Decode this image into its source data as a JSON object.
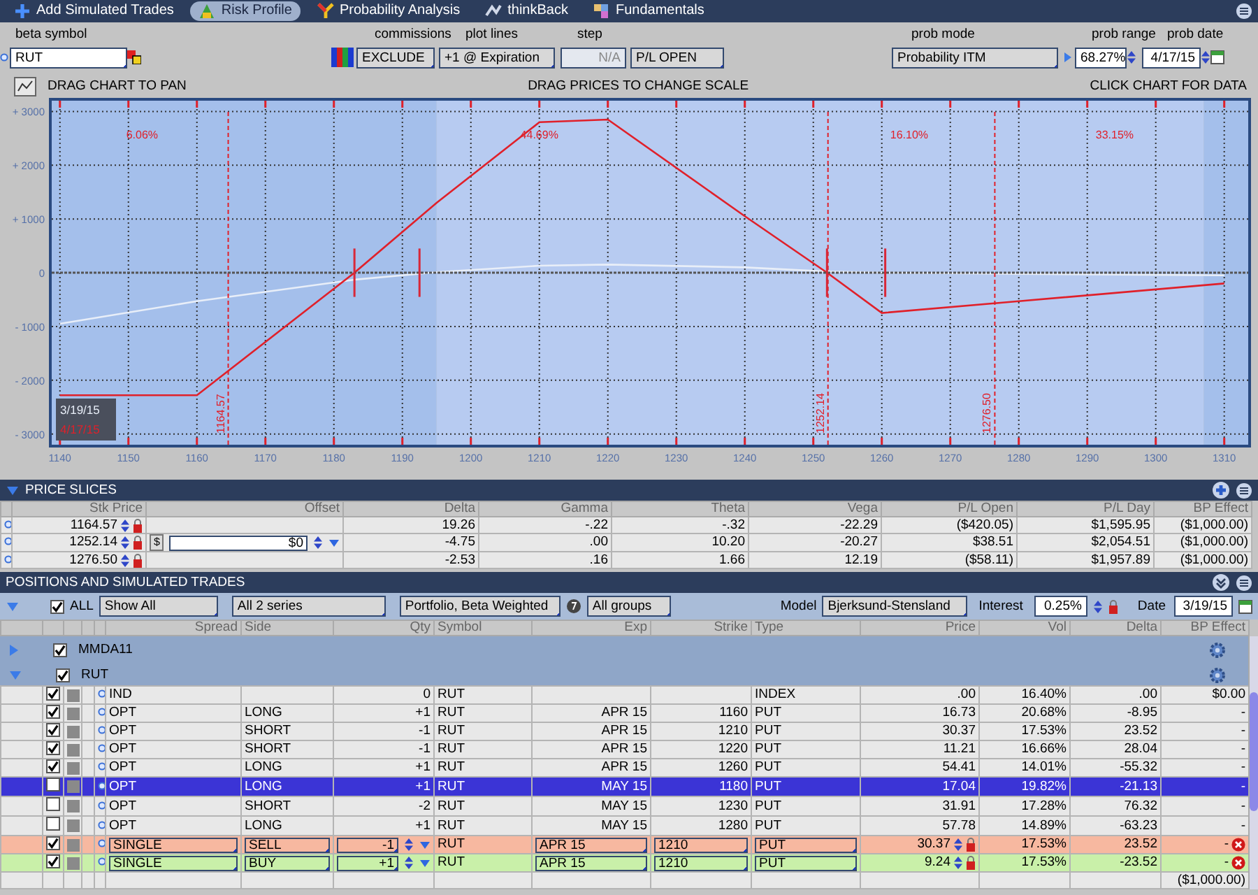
{
  "tabs": [
    {
      "label": "Add Simulated Trades",
      "selected": false
    },
    {
      "label": "Risk Profile",
      "selected": true
    },
    {
      "label": "Probability Analysis",
      "selected": false
    },
    {
      "label": "thinkBack",
      "selected": false
    },
    {
      "label": "Fundamentals",
      "selected": false
    }
  ],
  "settings": {
    "beta_symbol": {
      "label": "beta symbol",
      "value": "RUT"
    },
    "commissions": {
      "label": "commissions",
      "value": "EXCLUDE"
    },
    "plot_lines": {
      "label": "plot lines",
      "value": "+1 @ Expiration"
    },
    "step": {
      "label": "step",
      "value": "N/A",
      "disabled": true
    },
    "pl_mode": {
      "value": "P/L OPEN"
    },
    "prob_mode": {
      "label": "prob mode",
      "value": "Probability ITM"
    },
    "prob_range": {
      "label": "prob range",
      "value": "68.27%"
    },
    "prob_date": {
      "label": "prob date",
      "value": "4/17/15"
    }
  },
  "hints": [
    "DRAG CHART TO PAN",
    "DRAG PRICES TO CHANGE SCALE",
    "CLICK CHART FOR DATA"
  ],
  "risk_chart": {
    "chart_data": {
      "type": "line",
      "x": [
        1140,
        1160,
        1183,
        1195,
        1210,
        1220,
        1240,
        1252,
        1260,
        1280,
        1310
      ],
      "series": [
        {
          "name": "3/19/15",
          "color": "#e8eef8",
          "values": [
            -950,
            -530,
            -130,
            10,
            130,
            150,
            100,
            20,
            0,
            -20,
            -50
          ]
        },
        {
          "name": "4/17/15",
          "color": "#e0202a",
          "values": [
            -2280,
            -2280,
            0,
            1300,
            2800,
            2850,
            1050,
            0,
            -750,
            -530,
            -200
          ]
        }
      ],
      "xlim": [
        1138.8,
        1313.5
      ],
      "ylim": [
        -3200,
        3200
      ],
      "grid": true,
      "xticks": [
        1140,
        1150,
        1160,
        1170,
        1180,
        1190,
        1200,
        1210,
        1220,
        1230,
        1240,
        1250,
        1260,
        1270,
        1280,
        1290,
        1300,
        1310
      ],
      "yticks": [
        {
          "value": 3000,
          "label": "+ 3000"
        },
        {
          "value": 2000,
          "label": "+ 2000"
        },
        {
          "value": 1000,
          "label": "+ 1000"
        },
        {
          "value": 0,
          "label": "0"
        },
        {
          "value": -1000,
          "label": "- 1000"
        },
        {
          "value": -2000,
          "label": "- 2000"
        },
        {
          "value": -3000,
          "label": "- 3000"
        }
      ],
      "annotations": [
        "6.06%",
        "44.69%",
        "16.10%",
        "33.15%"
      ],
      "ref_lines": [
        {
          "axis": "x",
          "value": 1164.57,
          "label": "1164.57"
        },
        {
          "axis": "x",
          "value": 1252.14,
          "label": "1252.14"
        },
        {
          "axis": "x",
          "value": 1276.5,
          "label": "1276.50"
        },
        {
          "axis": "y",
          "value": 0
        }
      ],
      "bands": [
        {
          "axis": "x",
          "from": 1138.8,
          "to": 1195,
          "color": "#a4bfeb"
        },
        {
          "axis": "x",
          "from": 1195,
          "to": 1307,
          "color": "#b7cbf1"
        },
        {
          "axis": "x",
          "from": 1307,
          "to": 1313.5,
          "color": "#a4bfeb"
        }
      ]
    }
  },
  "price_slices": {
    "title": "PRICE SLICES",
    "columns": [
      "Stk Price",
      "Offset",
      "Delta",
      "Gamma",
      "Theta",
      "Vega",
      "P/L Open",
      "P/L Day",
      "BP Effect"
    ],
    "rows": [
      {
        "stk_price": "1164.57",
        "delta": "19.26",
        "gamma": "-.22",
        "theta": "-.32",
        "vega": "-22.29",
        "pl_open": "($420.05)",
        "pl_day": "$1,595.95",
        "bp_effect": "($1,000.00)"
      },
      {
        "stk_price": "1252.14",
        "offset_unit": "$",
        "offset": "$0",
        "delta": "-4.75",
        "gamma": ".00",
        "theta": "10.20",
        "vega": "-20.27",
        "pl_open": "$38.51",
        "pl_day": "$2,054.51",
        "bp_effect": "($1,000.00)"
      },
      {
        "stk_price": "1276.50",
        "delta": "-2.53",
        "gamma": ".16",
        "theta": "1.66",
        "vega": "12.19",
        "pl_open": "($58.11)",
        "pl_day": "$1,957.89",
        "bp_effect": "($1,000.00)"
      }
    ]
  },
  "positions": {
    "title": "POSITIONS AND SIMULATED TRADES",
    "filters": {
      "all_label": "ALL",
      "all_checked": true,
      "show": "Show All",
      "series": "All 2 series",
      "portfolio": "Portfolio, Beta Weighted",
      "groups": "All groups",
      "model_label": "Model",
      "model": "Bjerksund-Stensland",
      "interest_label": "Interest",
      "interest": "0.25%",
      "date_label": "Date",
      "date": "3/19/15"
    },
    "columns": [
      "Spread",
      "Side",
      "Qty",
      "Symbol",
      "Exp",
      "Strike",
      "Type",
      "Price",
      "Vol",
      "Delta",
      "BP Effect"
    ],
    "groups": [
      {
        "name": "MMDA11",
        "checked": true,
        "expanded": false
      },
      {
        "name": "RUT",
        "checked": true,
        "expanded": true,
        "rows": [
          {
            "kind": "position",
            "checked": true,
            "selected": false,
            "spread": "IND",
            "qty": "0",
            "symbol": "RUT",
            "type": "INDEX",
            "price": ".00",
            "vol": "16.40%",
            "delta": ".00",
            "bp_effect": "$0.00"
          },
          {
            "kind": "position",
            "checked": true,
            "selected": false,
            "spread": "OPT",
            "side": "LONG",
            "qty": "+1",
            "symbol": "RUT",
            "exp": "APR 15",
            "strike": "1160",
            "type": "PUT",
            "price": "16.73",
            "vol": "20.68%",
            "delta": "-8.95",
            "bp_effect": "-"
          },
          {
            "kind": "position",
            "checked": true,
            "selected": false,
            "spread": "OPT",
            "side": "SHORT",
            "qty": "-1",
            "symbol": "RUT",
            "exp": "APR 15",
            "strike": "1210",
            "type": "PUT",
            "price": "30.37",
            "vol": "17.53%",
            "delta": "23.52",
            "bp_effect": "-"
          },
          {
            "kind": "position",
            "checked": true,
            "selected": false,
            "spread": "OPT",
            "side": "SHORT",
            "qty": "-1",
            "symbol": "RUT",
            "exp": "APR 15",
            "strike": "1220",
            "type": "PUT",
            "price": "11.21",
            "vol": "16.66%",
            "delta": "28.04",
            "bp_effect": "-"
          },
          {
            "kind": "position",
            "checked": true,
            "selected": false,
            "spread": "OPT",
            "side": "LONG",
            "qty": "+1",
            "symbol": "RUT",
            "exp": "APR 15",
            "strike": "1260",
            "type": "PUT",
            "price": "54.41",
            "vol": "14.01%",
            "delta": "-55.32",
            "bp_effect": "-"
          },
          {
            "kind": "position",
            "checked": false,
            "selected": true,
            "spread": "OPT",
            "side": "LONG",
            "qty": "+1",
            "symbol": "RUT",
            "exp": "MAY 15",
            "strike": "1180",
            "type": "PUT",
            "price": "17.04",
            "vol": "19.82%",
            "delta": "-21.13",
            "bp_effect": "-"
          },
          {
            "kind": "position",
            "checked": false,
            "selected": false,
            "spread": "OPT",
            "side": "SHORT",
            "qty": "-2",
            "symbol": "RUT",
            "exp": "MAY 15",
            "strike": "1230",
            "type": "PUT",
            "price": "31.91",
            "vol": "17.28%",
            "delta": "76.32",
            "bp_effect": "-"
          },
          {
            "kind": "position",
            "checked": false,
            "selected": false,
            "spread": "OPT",
            "side": "LONG",
            "qty": "+1",
            "symbol": "RUT",
            "exp": "MAY 15",
            "strike": "1280",
            "type": "PUT",
            "price": "57.78",
            "vol": "14.89%",
            "delta": "-63.23",
            "bp_effect": "-"
          },
          {
            "kind": "sell",
            "checked": true,
            "selected": false,
            "spread": "SINGLE",
            "side": "SELL",
            "qty": "-1",
            "symbol": "RUT",
            "exp": "APR 15",
            "strike": "1210",
            "type": "PUT",
            "price": "30.37",
            "vol": "17.53%",
            "delta": "23.52",
            "bp_effect": "-"
          },
          {
            "kind": "buy",
            "checked": true,
            "selected": false,
            "spread": "SINGLE",
            "side": "BUY",
            "qty": "+1",
            "symbol": "RUT",
            "exp": "APR 15",
            "strike": "1210",
            "type": "PUT",
            "price": "9.24",
            "vol": "17.53%",
            "delta": "-23.52",
            "bp_effect": "-"
          }
        ]
      }
    ],
    "total_bp_effect": "($1,000.00)"
  }
}
